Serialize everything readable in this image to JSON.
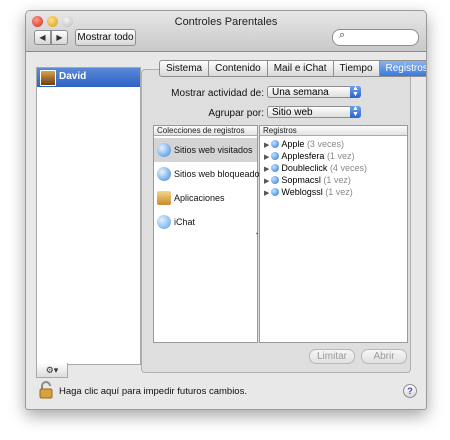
{
  "window": {
    "title": "Controles Parentales"
  },
  "toolbar": {
    "show_all_label": "Mostrar todo",
    "back_glyph": "◀",
    "forward_glyph": "▶",
    "search_glyph": "⌕"
  },
  "users": [
    {
      "name": "David"
    }
  ],
  "footer_left": {
    "gear_label": "⚙▾"
  },
  "tabs": [
    {
      "label": "Sistema",
      "active": false
    },
    {
      "label": "Contenido",
      "active": false
    },
    {
      "label": "Mail e iChat",
      "active": false
    },
    {
      "label": "Tiempo",
      "active": false
    },
    {
      "label": "Registros",
      "active": true
    }
  ],
  "filters": {
    "activity_label": "Mostrar actividad de:",
    "activity_value": "Una semana",
    "group_label": "Agrupar por:",
    "group_value": "Sitio web"
  },
  "collections": {
    "header": "Colecciones de registros",
    "items": [
      {
        "label": "Sitios web visitados",
        "icon": "safari-icon",
        "selected": true
      },
      {
        "label": "Sitios web bloqueados",
        "icon": "safari-icon",
        "selected": false
      },
      {
        "label": "Aplicaciones",
        "icon": "applications-icon",
        "selected": false
      },
      {
        "label": "iChat",
        "icon": "ichat-icon",
        "selected": false
      }
    ]
  },
  "logs": {
    "header": "Registros",
    "items": [
      {
        "site": "Apple",
        "count": "(3 veces)"
      },
      {
        "site": "Applesfera",
        "count": "(1 vez)"
      },
      {
        "site": "Doubleclick",
        "count": "(4 veces)"
      },
      {
        "site": "Sopmacsl",
        "count": "(1 vez)"
      },
      {
        "site": "Weblogssl",
        "count": "(1 vez)"
      }
    ]
  },
  "buttons": {
    "restrict_label": "Limitar",
    "open_label": "Abrir"
  },
  "bottom": {
    "lock_text": "Haga clic aquí para impedir futuros cambios.",
    "help_label": "?"
  },
  "colors": {
    "selection": "#3875d7",
    "window_bg": "#e8e8e8"
  }
}
